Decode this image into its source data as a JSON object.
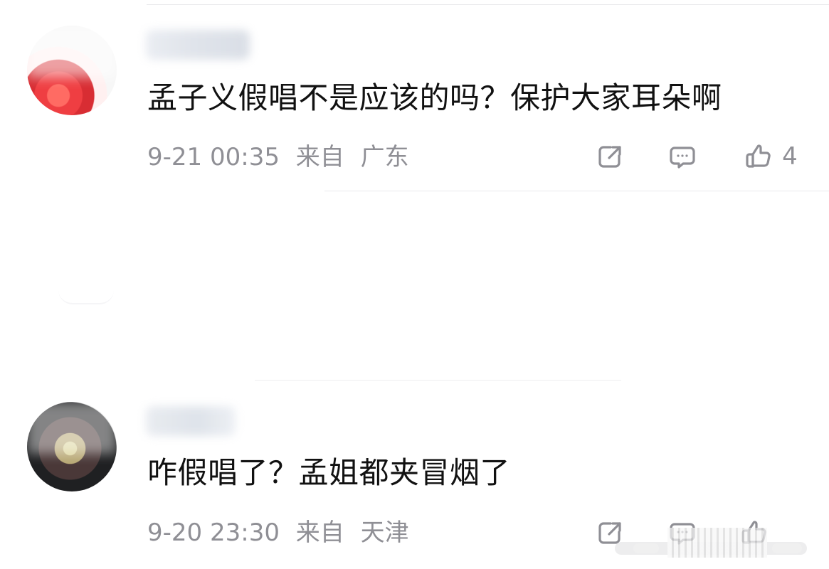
{
  "comments": [
    {
      "text": "孟子义假唱不是应该的吗？保护大家耳朵啊",
      "date": "9-21 00:35",
      "source_label": "来自",
      "location": "广东",
      "like_count": "4"
    },
    {
      "text": "咋假唱了？孟姐都夹冒烟了",
      "date": "9-20 23:30",
      "source_label": "来自",
      "location": "天津"
    }
  ],
  "icons": {
    "share": "share-icon",
    "comment": "comment-icon",
    "like": "like-icon"
  },
  "colors": {
    "background": "#ffffff",
    "text": "#111111",
    "meta": "#8f8f95",
    "divider": "#e9e9ec"
  }
}
